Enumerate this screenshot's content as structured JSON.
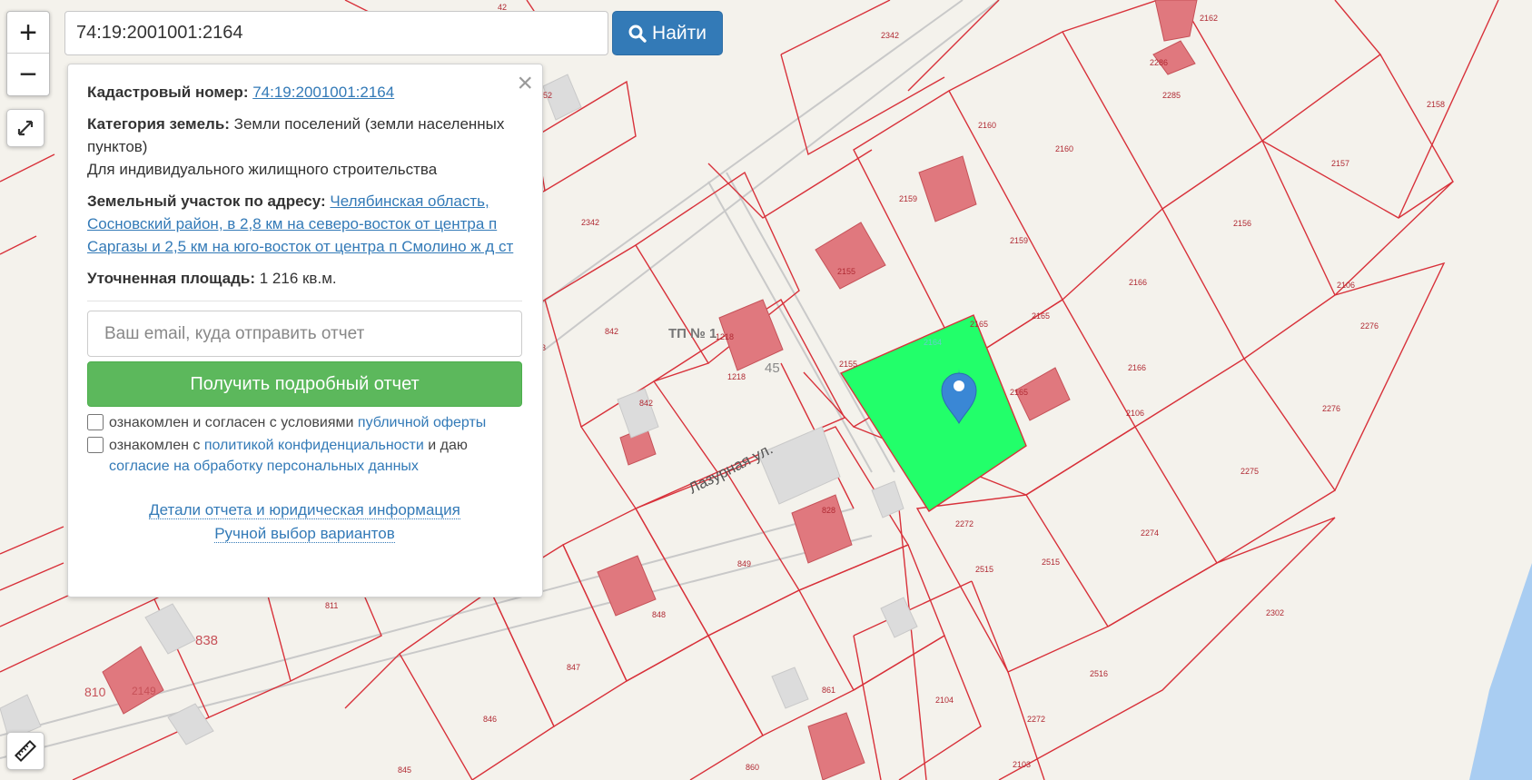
{
  "search": {
    "value": "74:19:2001001:2164",
    "button_label": "Найти"
  },
  "zoom": {
    "in_label": "+",
    "out_label": "−"
  },
  "panel": {
    "cadastral_label": "Кадастровый номер:",
    "cadastral_value": "74:19:2001001:2164",
    "category_label": "Категория земель:",
    "category_value": "Земли поселений (земли населенных пунктов)",
    "usage": "Для индивидуального жилищного строительства",
    "address_label": "Земельный участок по адресу:",
    "address_value": "Челябинская область, Сосновский район, в 2,8 км на северо-восток от центра п Саргазы и 2,5 км на юго-восток от центра п Смолино ж д ст",
    "area_label": "Уточненная площадь:",
    "area_value": "1 216 кв.м.",
    "email_placeholder": "Ваш email, куда отправить отчет",
    "report_button": "Получить подробный отчет",
    "consent1_text": "ознакомлен и согласен с условиями",
    "consent1_link": "публичной оферты",
    "consent2_text": "ознакомлен с",
    "consent2_link": "политикой конфиденциальности",
    "consent2_mid": "и даю",
    "consent2_link2": "согласие на обработку персональных данных",
    "details_link": "Детали отчета и юридическая информация",
    "manual_link": "Ручной выбор вариантов"
  },
  "map": {
    "colors": {
      "background": "#f4f2ec",
      "boundary": "#d8313a",
      "building": "#e0787e",
      "selected": "#22ff6a",
      "water": "#a9cdf2",
      "marker": "#3a87d5"
    },
    "street_label": "Лазурная ул.",
    "tp_label": "ТП № 1",
    "parcel_labels": [
      "2342",
      "2342",
      "42",
      "52",
      "2160",
      "2160",
      "2285",
      "2286",
      "2162",
      "2158",
      "2157",
      "2159",
      "2159",
      "2155",
      "2155",
      "2165",
      "2165",
      "2164",
      "2165",
      "2106",
      "2106",
      "2156",
      "2166",
      "2166",
      "2276",
      "2276",
      "2275",
      "2272",
      "2274",
      "2515",
      "2515",
      "2516",
      "2302",
      "2272",
      "2103",
      "2104",
      "842",
      "842",
      "3",
      "1218",
      "1218",
      "45",
      "828",
      "849",
      "848",
      "847",
      "846",
      "845",
      "860",
      "861",
      "811",
      "838",
      "810",
      "2149"
    ]
  }
}
